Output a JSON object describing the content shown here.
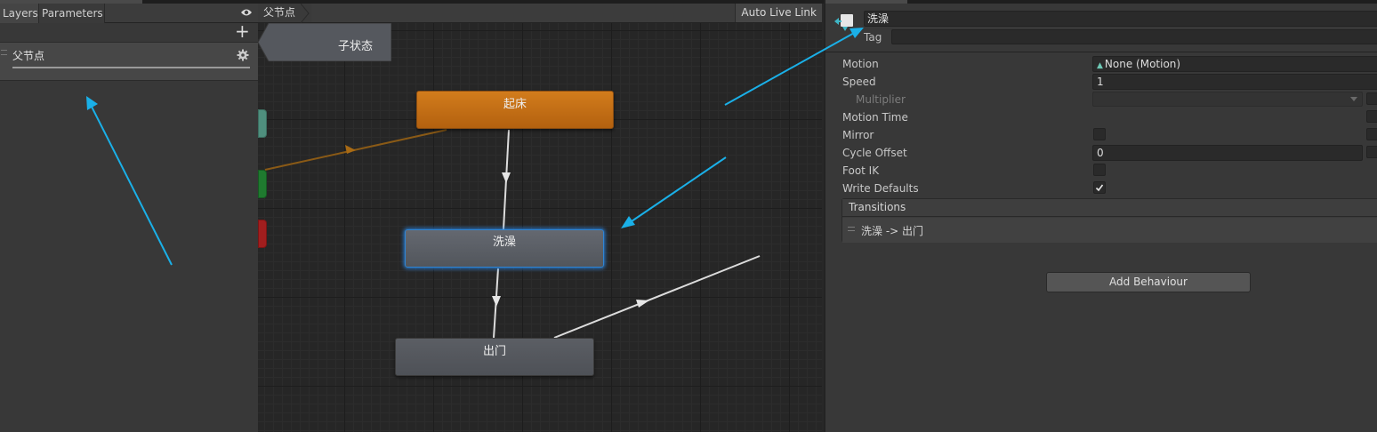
{
  "layers_panel": {
    "tabs": [
      "Layers",
      "Parameters"
    ],
    "add_label": "+",
    "layer": {
      "name": "父节点"
    }
  },
  "graph": {
    "breadcrumb": "父节点",
    "auto_live_link": "Auto Live Link",
    "states": {
      "qichuang": "起床",
      "xizao": "洗澡",
      "chumen": "出门",
      "substate": "子状态"
    },
    "colors": {
      "default_state": "#d27c1c",
      "selected_state_border": "#2f85d4",
      "entry": "#4f8f7e",
      "any_state": "#1f7a2f",
      "exit": "#a11e1e"
    }
  },
  "inspector": {
    "state_name": "洗澡",
    "tag_label": "Tag",
    "tag_value": "",
    "properties": {
      "motion_label": "Motion",
      "motion_value": "None (Motion)",
      "speed_label": "Speed",
      "speed_value": "1",
      "multiplier_label": "Multiplier",
      "motion_time_label": "Motion Time",
      "mirror_label": "Mirror",
      "mirror_checked": false,
      "cycle_offset_label": "Cycle Offset",
      "cycle_offset_value": "0",
      "foot_ik_label": "Foot IK",
      "foot_ik_checked": false,
      "write_defaults_label": "Write Defaults",
      "write_defaults_checked": true
    },
    "transitions": {
      "title": "Transitions",
      "items": [
        "洗澡 -> 出门"
      ]
    },
    "add_behaviour_label": "Add Behaviour"
  },
  "annotation_color": "#1ab0e8"
}
